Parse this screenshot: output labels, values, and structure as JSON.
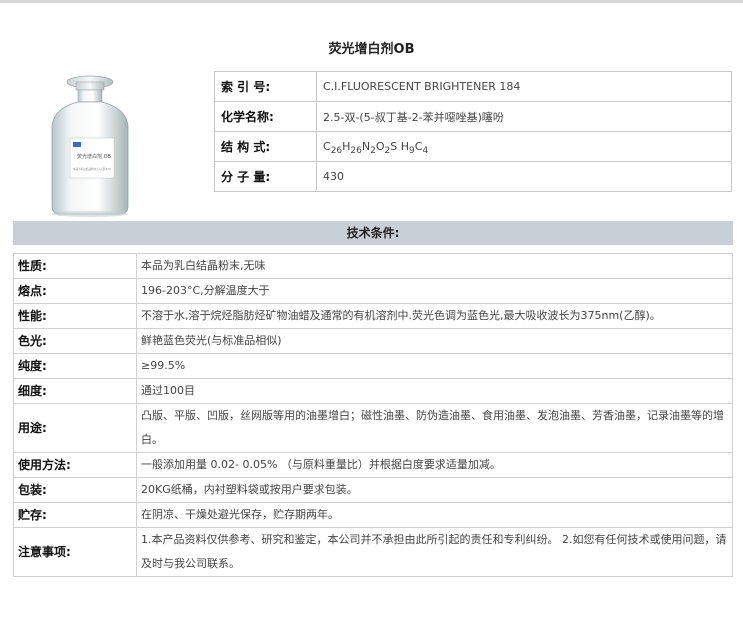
{
  "title": "荧光增白剂OB",
  "info": {
    "rows": [
      {
        "key": "索 引 号:",
        "value": "C.I.FLUORESCENT BRIGHTENER 184"
      },
      {
        "key": "化学名称:",
        "value": "2.5-双-(5-叔丁基-2-苯并噁唑基)噻吩"
      },
      {
        "key": "结 构 式:",
        "formula": [
          {
            "t": "C"
          },
          {
            "s": "26"
          },
          {
            "t": "H"
          },
          {
            "s": "26"
          },
          {
            "t": "N"
          },
          {
            "s": "2"
          },
          {
            "t": "O"
          },
          {
            "s": "2"
          },
          {
            "t": "S H"
          },
          {
            "s": "9"
          },
          {
            "t": "C"
          },
          {
            "s": "4"
          }
        ]
      },
      {
        "key": "分 子 量:",
        "value": "430"
      }
    ]
  },
  "photo": {
    "label_line1": "荧光增白剂 OB",
    "label_small": "本品为乳白结晶粉末 分子量 430"
  },
  "section_title": "技术条件:",
  "specs": {
    "rows": [
      {
        "key": "性质:",
        "value": "本品为乳白结晶粉末,无味"
      },
      {
        "key": "熔点:",
        "value": "196-203°C,分解温度大于"
      },
      {
        "key": "性能:",
        "value": "不溶于水,溶于烷烃脂肪烃矿物油蜡及通常的有机溶剂中.荧光色调为蓝色光,最大吸收波长为375nm(乙醇)。"
      },
      {
        "key": "色光:",
        "value": "鲜艳蓝色荧光(与标准品相似)"
      },
      {
        "key": "纯度:",
        "value": "≥99.5%"
      },
      {
        "key": "细度:",
        "value": "通过100目"
      },
      {
        "key": "用途:",
        "value": "凸版、平版、凹版，丝网版等用的油墨增白；磁性油墨、防伪造油墨、食用油墨、发泡油墨、芳香油墨，记录油墨等的增白。"
      },
      {
        "key": "使用方法:",
        "value": "一般添加用量 0.02- 0.05% （与原料重量比）并根据白度要求适量加减。"
      },
      {
        "key": "包装:",
        "value": "20KG纸桶，内衬塑料袋或按用户要求包装。"
      },
      {
        "key": "贮存:",
        "value": "在阴凉、干燥处避光保存，贮存期两年。"
      },
      {
        "key": "注意事项:",
        "value": "1.本产品资料仅供参考、研究和鉴定，本公司并不承担由此所引起的责任和专利纠纷。 2.如您有任何技术或使用问题，请及时与我公司联系。"
      }
    ]
  }
}
